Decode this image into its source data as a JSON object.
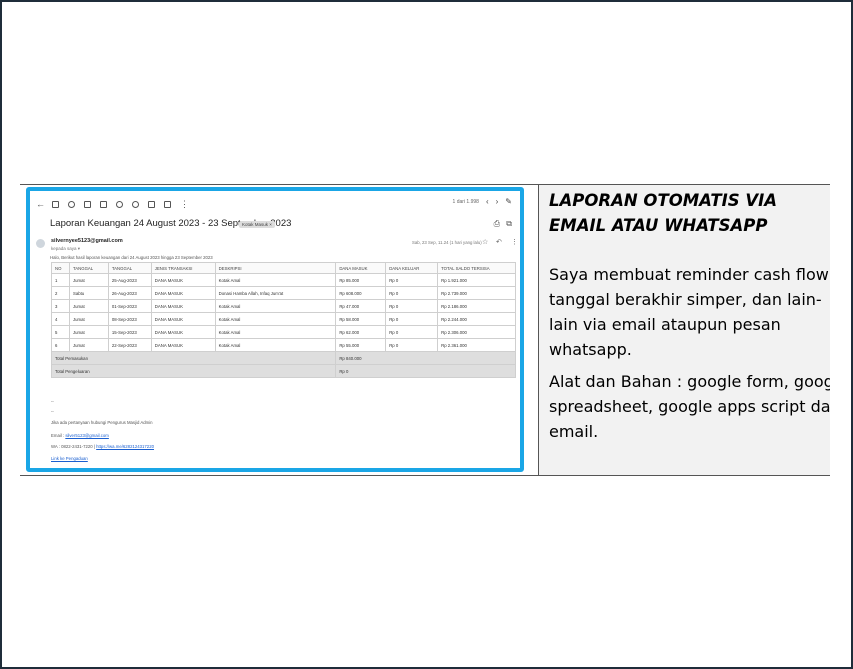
{
  "doc": {
    "title": "LAPORAN OTOMATIS VIA EMAIL ATAU WHATSAPP",
    "paragraph1": "Saya membuat reminder cash flow, tanggal berakhir simper, dan lain-lain via email ataupun pesan whatsapp.",
    "paragraph2": "Alat dan Bahan : google form, google spreadsheet, google apps script dan email."
  },
  "email": {
    "subject": "Laporan Keuangan 24 August 2023 - 23 September 2023",
    "label_chip": "Kotak Masuk ×",
    "pager": "1 dari 1.998",
    "from": "silvernyee5123@gmail.com",
    "to": "kepada saya ▾",
    "date": "Sab, 23 Sep, 11.24 (1 hari yang lalu)",
    "intro": "Halo, Berikut hasil laporan keuangan dari 24 August 2023 hingga 23 September 2023",
    "table": {
      "headers": [
        "NO",
        "TANGGAL",
        "TANGGAL",
        "JENIS TRANSAKSI",
        "DESKRIPSI",
        "DANA MASUK",
        "DANA KELUAR",
        "TOTAL SALDO TERSISA"
      ],
      "rows": [
        [
          "1",
          "Jumat",
          "25-Aug-2023",
          "DANA MASUK",
          "Kotak Amal",
          "Rp 85.000",
          "Rp 0",
          "Rp 1.921.000"
        ],
        [
          "2",
          "Sabtu",
          "26-Aug-2023",
          "DANA MASUK",
          "Donasi Hamba Allah, Infaq Jum'at",
          "Rp 608.000",
          "Rp 0",
          "Rp 2.739.000"
        ],
        [
          "3",
          "Jumat",
          "01-Sep-2023",
          "DANA MASUK",
          "Kotak Amal",
          "Rp 47.000",
          "Rp 0",
          "Rp 2.186.000"
        ],
        [
          "4",
          "Jumat",
          "08-Sep-2023",
          "DANA MASUK",
          "Kotak Amal",
          "Rp 58.000",
          "Rp 0",
          "Rp 2.244.000"
        ],
        [
          "5",
          "Jumat",
          "15-Sep-2023",
          "DANA MASUK",
          "Kotak Amal",
          "Rp 62.000",
          "Rp 0",
          "Rp 2.306.000"
        ],
        [
          "6",
          "Jumat",
          "22-Sep-2023",
          "DANA MASUK",
          "Kotak Amal",
          "Rp 55.000",
          "Rp 0",
          "Rp 2.361.000"
        ]
      ],
      "total_income_label": "Total Pemasukan",
      "total_income_value": "Rp 840.000",
      "total_expense_label": "Total Pengeluaran",
      "total_expense_value": "Rp 0"
    },
    "signature": {
      "dash1": "--",
      "dash2": "--",
      "note": "Jika ada pertanyaan hubungi Pengurus Masjid Admin",
      "email_label": "Email : ",
      "email_value": "silver5123@gmail.com",
      "wa_label": "WA : 0822-2431-7220 | ",
      "wa_link": "https://wa.me/6282124317220",
      "unsubscribe": "Link ke Pengaduan"
    }
  }
}
